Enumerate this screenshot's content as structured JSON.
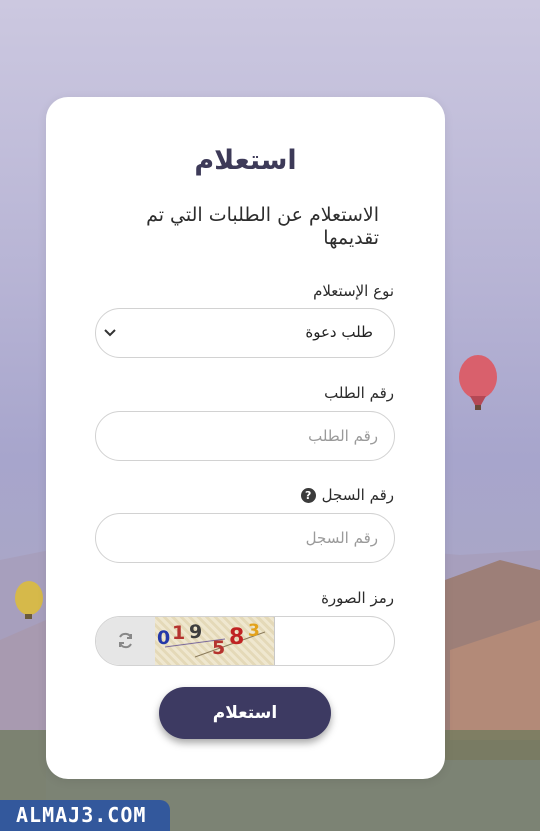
{
  "form": {
    "title": "استعلام",
    "subtitle": "الاستعلام عن الطلبات التي تم تقديمها",
    "inquiry_type": {
      "label": "نوع الإستعلام",
      "value": "طلب دعوة"
    },
    "request_number": {
      "label": "رقم الطلب",
      "placeholder": "رقم الطلب"
    },
    "record_number": {
      "label": "رقم السجل",
      "placeholder": "رقم السجل"
    },
    "captcha": {
      "label": "رمز الصورة",
      "digits": [
        "0",
        "1",
        "9",
        "5",
        "8",
        "3"
      ]
    },
    "submit_label": "استعلام"
  },
  "watermark": {
    "text": "ALMAJ3.COM"
  },
  "icons": {
    "help": "question-circle-icon",
    "refresh": "refresh-icon",
    "dropdown": "chevron-down-icon"
  },
  "colors": {
    "primary": "#3d3a62",
    "title": "#3d3a58",
    "watermark_bg": "#33589c"
  }
}
